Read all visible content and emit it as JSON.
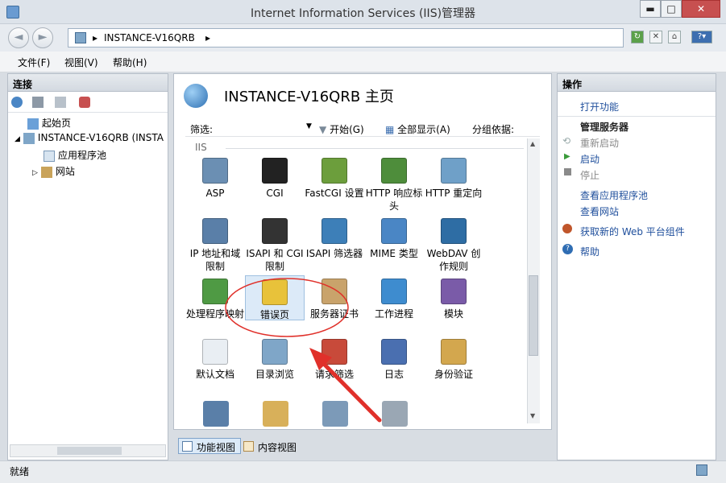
{
  "window": {
    "title": "Internet Information Services (IIS)管理器",
    "controls": {
      "minimize": "▬",
      "maximize": "□",
      "close": "✕"
    }
  },
  "address": {
    "separator": "▸",
    "path": "INSTANCE-V16QRB"
  },
  "menu": {
    "items": [
      "文件(F)",
      "视图(V)",
      "帮助(H)"
    ]
  },
  "connections": {
    "title": "连接",
    "tree": {
      "start_page": "起始页",
      "server": "INSTANCE-V16QRB (INSTA",
      "app_pools": "应用程序池",
      "sites": "网站"
    }
  },
  "main": {
    "title": "INSTANCE-V16QRB 主页",
    "filter_label": "筛选:",
    "start_label": "开始(G)",
    "show_all": "全部显示(A)",
    "group_by": "分组依据:",
    "group_name": "IIS",
    "features": [
      {
        "label": "ASP",
        "color": "#6b8fb3"
      },
      {
        "label": "CGI",
        "color": "#222222"
      },
      {
        "label": "FastCGI 设置",
        "color": "#6c9e3c"
      },
      {
        "label": "HTTP 响应标头",
        "color": "#4e8d3b"
      },
      {
        "label": "HTTP 重定向",
        "color": "#6fa0c8"
      },
      {
        "label": "IP 地址和域限制",
        "color": "#5a7fa8"
      },
      {
        "label": "ISAPI 和 CGI 限制",
        "color": "#333333"
      },
      {
        "label": "ISAPI 筛选器",
        "color": "#3d7fb8"
      },
      {
        "label": "MIME 类型",
        "color": "#4a86c5"
      },
      {
        "label": "WebDAV 创作规则",
        "color": "#2e6da4"
      },
      {
        "label": "处理程序映射",
        "color": "#4f9a44"
      },
      {
        "label": "错误页",
        "color": "#e8c23a"
      },
      {
        "label": "服务器证书",
        "color": "#c9a36b"
      },
      {
        "label": "工作进程",
        "color": "#3e8ccf"
      },
      {
        "label": "模块",
        "color": "#7a5ba8"
      },
      {
        "label": "默认文档",
        "color": "#e9eef3"
      },
      {
        "label": "目录浏览",
        "color": "#7fa6c8"
      },
      {
        "label": "请求筛选",
        "color": "#c84a3a"
      },
      {
        "label": "日志",
        "color": "#4a6fb0"
      },
      {
        "label": "身份验证",
        "color": "#d3a74e"
      }
    ],
    "row5_colors": [
      "#5a7fa8",
      "#d8b05a",
      "#7c9ab8",
      "#9aa7b4"
    ]
  },
  "view_tabs": {
    "features": "功能视图",
    "content": "内容视图"
  },
  "actions": {
    "title": "操作",
    "open_feature": "打开功能",
    "manage_server": "管理服务器",
    "restart": "重新启动",
    "start": "启动",
    "stop": "停止",
    "view_app_pools": "查看应用程序池",
    "view_sites": "查看网站",
    "get_web_platform": "获取新的 Web 平台组件",
    "help": "帮助"
  },
  "status": {
    "text": "就绪"
  },
  "colors": {
    "accent_link": "#1f4f9c",
    "annotation": "#e0302a",
    "selected": "#dceaf8"
  }
}
